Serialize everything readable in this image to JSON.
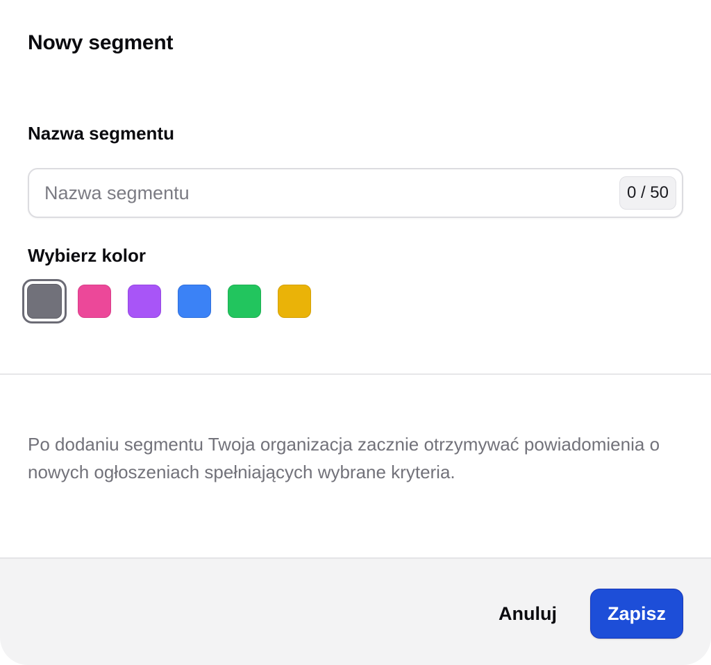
{
  "dialog": {
    "title": "Nowy segment"
  },
  "name_field": {
    "label": "Nazwa segmentu",
    "value": "",
    "placeholder": "Nazwa segmentu",
    "counter": "0 / 50"
  },
  "color_picker": {
    "label": "Wybierz kolor",
    "selected": "gray",
    "swatches": [
      {
        "name": "gray",
        "color": "#71717a",
        "border": "#5d5d66"
      },
      {
        "name": "pink",
        "color": "#ec4899",
        "border": "#d93c88"
      },
      {
        "name": "purple",
        "color": "#a855f7",
        "border": "#9446e2"
      },
      {
        "name": "blue",
        "color": "#3b82f6",
        "border": "#2f6fdc"
      },
      {
        "name": "green",
        "color": "#22c55e",
        "border": "#1caf52"
      },
      {
        "name": "yellow",
        "color": "#eab308",
        "border": "#d4a006"
      }
    ]
  },
  "info": {
    "text": "Po dodaniu segmentu Twoja organizacja zacznie otrzymywać powiadomienia o nowych ogłoszeniach spełniających wybrane kryteria."
  },
  "footer": {
    "cancel_label": "Anuluj",
    "save_label": "Zapisz",
    "save_color": "#1d4ed8"
  }
}
